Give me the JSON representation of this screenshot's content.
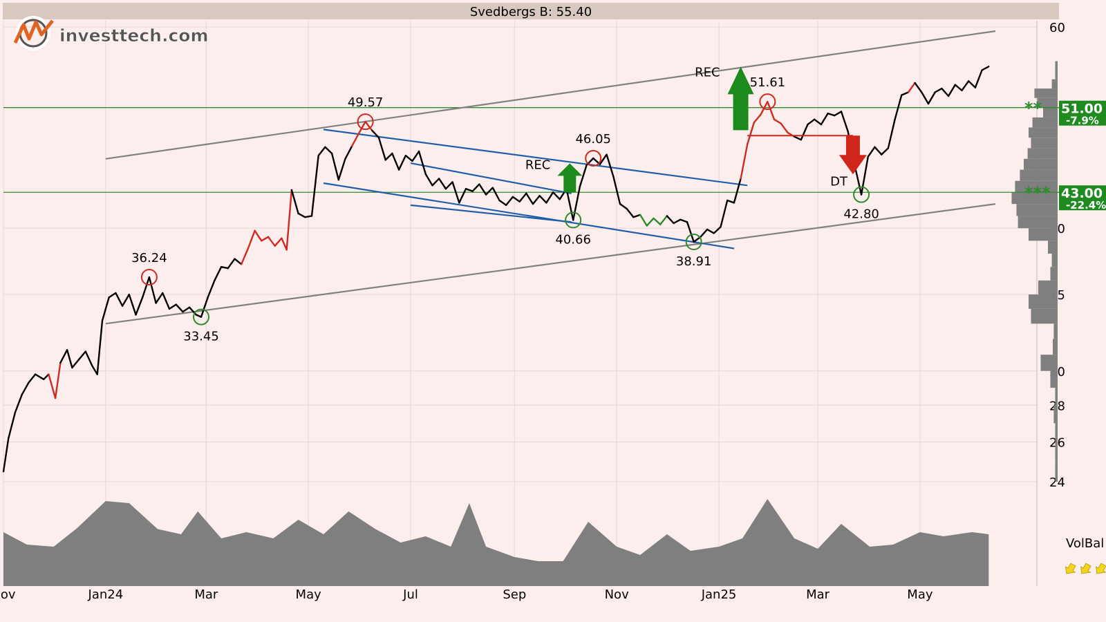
{
  "header": {
    "title": "Svedbergs B: 55.40"
  },
  "logo": {
    "brand": "investtech.com"
  },
  "colors": {
    "price_line": "#000000",
    "price_up": "#2a8a2a",
    "price_down": "#cc2b1e",
    "trend_channel": "#1f5fa8",
    "long_channel": "#808080",
    "support_resistance": "#2e8b2e",
    "volume_area": "#7f7f7f",
    "header_bg": "#d8c8bf",
    "plot_bg": "#fdeeee",
    "level_badge": "#1f8a1f",
    "buy_arrow": "#1d8a1d",
    "sell_arrow": "#d0261a",
    "volbal_arrows": "#f2d421"
  },
  "chart_data": {
    "type": "line",
    "scale": "log",
    "title": "Svedbergs B: 55.40",
    "ylim": [
      24,
      62
    ],
    "y_ticks": [
      24,
      26,
      28,
      30,
      35,
      40,
      60
    ],
    "x_ticks": [
      "Nov",
      "Jan24",
      "Mar",
      "May",
      "Jul",
      "Sep",
      "Nov",
      "Jan25",
      "Mar",
      "May"
    ],
    "x_range": [
      "2023-11-01",
      "2025-06-15"
    ],
    "grid": true,
    "series": [
      {
        "values_by_date": [
          [
            "2023-11-01",
            24.5
          ],
          [
            "2023-11-04",
            26.2
          ],
          [
            "2023-11-08",
            27.6
          ],
          [
            "2023-11-12",
            28.6
          ],
          [
            "2023-11-16",
            29.3
          ],
          [
            "2023-11-20",
            29.8
          ],
          [
            "2023-11-25",
            29.5
          ],
          [
            "2023-11-28",
            29.8
          ],
          [
            "2023-12-02",
            28.4
          ],
          [
            "2023-12-05",
            30.5
          ],
          [
            "2023-12-09",
            31.3
          ],
          [
            "2023-12-12",
            30.2
          ],
          [
            "2023-12-16",
            30.7
          ],
          [
            "2023-12-20",
            31.2
          ],
          [
            "2023-12-24",
            30.3
          ],
          [
            "2023-12-27",
            29.8
          ],
          [
            "2023-12-30",
            33.2
          ],
          [
            "2024-01-03",
            34.8
          ],
          [
            "2024-01-07",
            35.1
          ],
          [
            "2024-01-11",
            34.2
          ],
          [
            "2024-01-15",
            35.0
          ],
          [
            "2024-01-19",
            33.6
          ],
          [
            "2024-01-23",
            34.8
          ],
          [
            "2024-01-27",
            36.24
          ],
          [
            "2024-01-31",
            34.4
          ],
          [
            "2024-02-04",
            35.1
          ],
          [
            "2024-02-08",
            34.0
          ],
          [
            "2024-02-12",
            34.3
          ],
          [
            "2024-02-16",
            33.8
          ],
          [
            "2024-02-20",
            34.1
          ],
          [
            "2024-02-24",
            33.6
          ],
          [
            "2024-02-27",
            33.45
          ],
          [
            "2024-03-02",
            34.8
          ],
          [
            "2024-03-06",
            36.0
          ],
          [
            "2024-03-10",
            37.0
          ],
          [
            "2024-03-14",
            36.9
          ],
          [
            "2024-03-18",
            37.6
          ],
          [
            "2024-03-22",
            37.2
          ],
          [
            "2024-03-26",
            38.4
          ],
          [
            "2024-03-30",
            39.8
          ],
          [
            "2024-04-03",
            39.0
          ],
          [
            "2024-04-07",
            39.3
          ],
          [
            "2024-04-11",
            38.6
          ],
          [
            "2024-04-15",
            39.2
          ],
          [
            "2024-04-18",
            38.3
          ],
          [
            "2024-04-21",
            43.2
          ],
          [
            "2024-04-25",
            41.2
          ],
          [
            "2024-04-29",
            40.9
          ],
          [
            "2024-05-03",
            41.0
          ],
          [
            "2024-05-07",
            46.3
          ],
          [
            "2024-05-11",
            47.1
          ],
          [
            "2024-05-15",
            46.5
          ],
          [
            "2024-05-19",
            44.1
          ],
          [
            "2024-05-23",
            46.0
          ],
          [
            "2024-05-27",
            47.2
          ],
          [
            "2024-05-31",
            48.4
          ],
          [
            "2024-06-04",
            49.57
          ],
          [
            "2024-06-08",
            48.7
          ],
          [
            "2024-06-12",
            48.0
          ],
          [
            "2024-06-16",
            45.9
          ],
          [
            "2024-06-20",
            46.5
          ],
          [
            "2024-06-24",
            45.0
          ],
          [
            "2024-06-28",
            46.3
          ],
          [
            "2024-07-02",
            45.8
          ],
          [
            "2024-07-06",
            46.7
          ],
          [
            "2024-07-10",
            44.6
          ],
          [
            "2024-07-14",
            43.6
          ],
          [
            "2024-07-18",
            44.2
          ],
          [
            "2024-07-22",
            43.3
          ],
          [
            "2024-07-26",
            43.9
          ],
          [
            "2024-07-30",
            42.1
          ],
          [
            "2024-08-03",
            43.3
          ],
          [
            "2024-08-07",
            43.1
          ],
          [
            "2024-08-11",
            43.7
          ],
          [
            "2024-08-15",
            42.8
          ],
          [
            "2024-08-19",
            43.4
          ],
          [
            "2024-08-23",
            42.3
          ],
          [
            "2024-08-27",
            41.9
          ],
          [
            "2024-08-31",
            42.6
          ],
          [
            "2024-09-04",
            42.2
          ],
          [
            "2024-09-08",
            42.9
          ],
          [
            "2024-09-12",
            42.0
          ],
          [
            "2024-09-16",
            42.7
          ],
          [
            "2024-09-20",
            42.1
          ],
          [
            "2024-09-24",
            43.0
          ],
          [
            "2024-09-28",
            42.4
          ],
          [
            "2024-10-02",
            43.3
          ],
          [
            "2024-10-06",
            40.66
          ],
          [
            "2024-10-10",
            43.5
          ],
          [
            "2024-10-14",
            45.4
          ],
          [
            "2024-10-18",
            46.05
          ],
          [
            "2024-10-22",
            45.5
          ],
          [
            "2024-10-26",
            46.4
          ],
          [
            "2024-10-30",
            44.4
          ],
          [
            "2024-11-03",
            42.0
          ],
          [
            "2024-11-07",
            41.6
          ],
          [
            "2024-11-11",
            40.9
          ],
          [
            "2024-11-15",
            41.1
          ],
          [
            "2024-11-19",
            40.2
          ],
          [
            "2024-11-23",
            40.8
          ],
          [
            "2024-11-27",
            40.3
          ],
          [
            "2024-12-01",
            41.0
          ],
          [
            "2024-12-05",
            40.4
          ],
          [
            "2024-12-09",
            40.7
          ],
          [
            "2024-12-13",
            40.5
          ],
          [
            "2024-12-17",
            38.91
          ],
          [
            "2024-12-21",
            39.3
          ],
          [
            "2024-12-25",
            39.9
          ],
          [
            "2024-12-29",
            39.6
          ],
          [
            "2025-01-02",
            40.1
          ],
          [
            "2025-01-06",
            42.3
          ],
          [
            "2025-01-10",
            42.1
          ],
          [
            "2025-01-14",
            44.2
          ],
          [
            "2025-01-18",
            47.4
          ],
          [
            "2025-01-22",
            49.5
          ],
          [
            "2025-01-26",
            50.3
          ],
          [
            "2025-01-30",
            51.61
          ],
          [
            "2025-02-03",
            49.8
          ],
          [
            "2025-02-07",
            49.4
          ],
          [
            "2025-02-11",
            48.5
          ],
          [
            "2025-02-15",
            48.1
          ],
          [
            "2025-02-19",
            47.8
          ],
          [
            "2025-02-23",
            49.3
          ],
          [
            "2025-02-27",
            49.8
          ],
          [
            "2025-03-03",
            49.3
          ],
          [
            "2025-03-07",
            50.4
          ],
          [
            "2025-03-11",
            50.2
          ],
          [
            "2025-03-15",
            50.6
          ],
          [
            "2025-03-19",
            48.6
          ],
          [
            "2025-03-23",
            45.4
          ],
          [
            "2025-03-27",
            42.8
          ],
          [
            "2025-03-31",
            46.2
          ],
          [
            "2025-04-04",
            47.1
          ],
          [
            "2025-04-08",
            46.4
          ],
          [
            "2025-04-12",
            47.0
          ],
          [
            "2025-04-16",
            49.8
          ],
          [
            "2025-04-20",
            52.3
          ],
          [
            "2025-04-24",
            52.6
          ],
          [
            "2025-04-28",
            53.6
          ],
          [
            "2025-05-02",
            52.6
          ],
          [
            "2025-05-06",
            51.4
          ],
          [
            "2025-05-10",
            52.6
          ],
          [
            "2025-05-14",
            53.0
          ],
          [
            "2025-05-18",
            52.2
          ],
          [
            "2025-05-22",
            53.4
          ],
          [
            "2025-05-26",
            52.8
          ],
          [
            "2025-05-30",
            53.8
          ],
          [
            "2025-06-03",
            53.1
          ],
          [
            "2025-06-07",
            55.0
          ],
          [
            "2025-06-11",
            55.4
          ]
        ]
      }
    ],
    "red_segments": [
      [
        "2023-11-28",
        "2023-12-05"
      ],
      [
        "2024-03-22",
        "2024-04-21"
      ],
      [
        "2024-05-27",
        "2024-06-08"
      ],
      [
        "2025-01-14",
        "2025-02-15"
      ],
      [
        "2025-04-24",
        "2025-04-28"
      ]
    ],
    "green_segments": [
      [
        "2024-11-15",
        "2024-12-01"
      ]
    ],
    "peak_troughs": [
      {
        "date": "2024-01-27",
        "value": 36.24,
        "kind": "top",
        "label": "36.24"
      },
      {
        "date": "2024-02-27",
        "value": 33.45,
        "kind": "bottom",
        "label": "33.45"
      },
      {
        "date": "2024-06-04",
        "value": 49.57,
        "kind": "top",
        "label": "49.57"
      },
      {
        "date": "2024-10-06",
        "value": 40.66,
        "kind": "bottom",
        "label": "40.66"
      },
      {
        "date": "2024-10-18",
        "value": 46.05,
        "kind": "top",
        "label": "46.05"
      },
      {
        "date": "2024-12-17",
        "value": 38.91,
        "kind": "bottom",
        "label": "38.91"
      },
      {
        "date": "2025-01-30",
        "value": 51.61,
        "kind": "top",
        "label": "51.61"
      },
      {
        "date": "2025-03-27",
        "value": 42.8,
        "kind": "bottom",
        "label": "42.80"
      }
    ],
    "trendlines": [
      {
        "kind": "long",
        "from": [
          "2024-01-01",
          33.0
        ],
        "to": [
          "2025-06-15",
          42.0
        ]
      },
      {
        "kind": "long",
        "from": [
          "2024-01-01",
          46.0
        ],
        "to": [
          "2025-06-15",
          59.5
        ]
      },
      {
        "kind": "channel",
        "from": [
          "2024-05-10",
          48.8
        ],
        "to": [
          "2025-01-18",
          43.6
        ]
      },
      {
        "kind": "channel",
        "from": [
          "2024-05-10",
          43.8
        ],
        "to": [
          "2025-01-10",
          38.4
        ]
      },
      {
        "kind": "channel",
        "from": [
          "2024-07-01",
          45.6
        ],
        "to": [
          "2024-10-05",
          42.9
        ]
      },
      {
        "kind": "channel",
        "from": [
          "2024-07-01",
          41.9
        ],
        "to": [
          "2024-10-05",
          40.5
        ]
      }
    ],
    "levels": [
      {
        "value": 51.0,
        "label": "51.00",
        "change": "-7.9%"
      },
      {
        "value": 43.0,
        "label": "43.00",
        "change": "-22.4%"
      }
    ],
    "signals": [
      {
        "label": "REC",
        "date": "2024-10-04",
        "value": 44.7,
        "direction": "up"
      },
      {
        "label": "REC",
        "date": "2025-01-14",
        "value": 50.6,
        "direction": "up"
      },
      {
        "label": "DT",
        "date": "2025-03-22",
        "value": 48.2,
        "direction": "down"
      }
    ],
    "dt_formation_level": 48.2,
    "volume_balance": {
      "label": "VolBal",
      "values_by_date": [
        [
          "2023-11-01",
          0.52
        ],
        [
          "2023-11-15",
          0.4
        ],
        [
          "2023-12-01",
          0.38
        ],
        [
          "2023-12-15",
          0.56
        ],
        [
          "2024-01-01",
          0.82
        ],
        [
          "2024-01-15",
          0.8
        ],
        [
          "2024-02-01",
          0.55
        ],
        [
          "2024-02-15",
          0.5
        ],
        [
          "2024-02-25",
          0.72
        ],
        [
          "2024-03-10",
          0.46
        ],
        [
          "2024-03-25",
          0.52
        ],
        [
          "2024-04-10",
          0.46
        ],
        [
          "2024-04-25",
          0.64
        ],
        [
          "2024-05-10",
          0.5
        ],
        [
          "2024-05-25",
          0.72
        ],
        [
          "2024-06-10",
          0.55
        ],
        [
          "2024-06-25",
          0.42
        ],
        [
          "2024-07-10",
          0.48
        ],
        [
          "2024-07-25",
          0.38
        ],
        [
          "2024-08-05",
          0.8
        ],
        [
          "2024-08-15",
          0.38
        ],
        [
          "2024-09-01",
          0.28
        ],
        [
          "2024-09-15",
          0.24
        ],
        [
          "2024-09-30",
          0.24
        ],
        [
          "2024-10-15",
          0.62
        ],
        [
          "2024-11-01",
          0.38
        ],
        [
          "2024-11-15",
          0.3
        ],
        [
          "2024-12-01",
          0.5
        ],
        [
          "2024-12-15",
          0.34
        ],
        [
          "2025-01-01",
          0.38
        ],
        [
          "2025-01-15",
          0.46
        ],
        [
          "2025-01-30",
          0.84
        ],
        [
          "2025-02-15",
          0.46
        ],
        [
          "2025-03-01",
          0.36
        ],
        [
          "2025-03-15",
          0.6
        ],
        [
          "2025-04-01",
          0.38
        ],
        [
          "2025-04-15",
          0.4
        ],
        [
          "2025-05-01",
          0.52
        ],
        [
          "2025-05-15",
          0.48
        ],
        [
          "2025-06-01",
          0.52
        ],
        [
          "2025-06-11",
          0.5
        ]
      ]
    },
    "volume_profile": [
      {
        "price": 24.5,
        "volume": 0.05
      },
      {
        "price": 25.5,
        "volume": 0.05
      },
      {
        "price": 26.5,
        "volume": 0.05
      },
      {
        "price": 27.5,
        "volume": 0.08
      },
      {
        "price": 28.5,
        "volume": 0.05
      },
      {
        "price": 29.5,
        "volume": 0.15
      },
      {
        "price": 30.5,
        "volume": 0.35
      },
      {
        "price": 31.5,
        "volume": 0.1
      },
      {
        "price": 32.5,
        "volume": 0.08
      },
      {
        "price": 33.5,
        "volume": 0.55
      },
      {
        "price": 34.5,
        "volume": 0.6
      },
      {
        "price": 35.5,
        "volume": 0.4
      },
      {
        "price": 36.5,
        "volume": 0.15
      },
      {
        "price": 37.5,
        "volume": 0.12
      },
      {
        "price": 38.5,
        "volume": 0.2
      },
      {
        "price": 39.5,
        "volume": 0.6
      },
      {
        "price": 40.5,
        "volume": 0.82
      },
      {
        "price": 41.5,
        "volume": 0.85
      },
      {
        "price": 42.5,
        "volume": 0.95
      },
      {
        "price": 43.5,
        "volume": 0.88
      },
      {
        "price": 44.5,
        "volume": 0.78
      },
      {
        "price": 45.5,
        "volume": 0.7
      },
      {
        "price": 46.5,
        "volume": 0.62
      },
      {
        "price": 47.5,
        "volume": 0.55
      },
      {
        "price": 48.5,
        "volume": 0.6
      },
      {
        "price": 49.5,
        "volume": 0.52
      },
      {
        "price": 50.5,
        "volume": 0.3
      },
      {
        "price": 51.5,
        "volume": 0.42
      },
      {
        "price": 52.5,
        "volume": 0.48
      },
      {
        "price": 53.5,
        "volume": 0.12
      },
      {
        "price": 54.5,
        "volume": 0.05
      },
      {
        "price": 55.5,
        "volume": 0.05
      }
    ],
    "volbal_signal": "up-arrows"
  }
}
